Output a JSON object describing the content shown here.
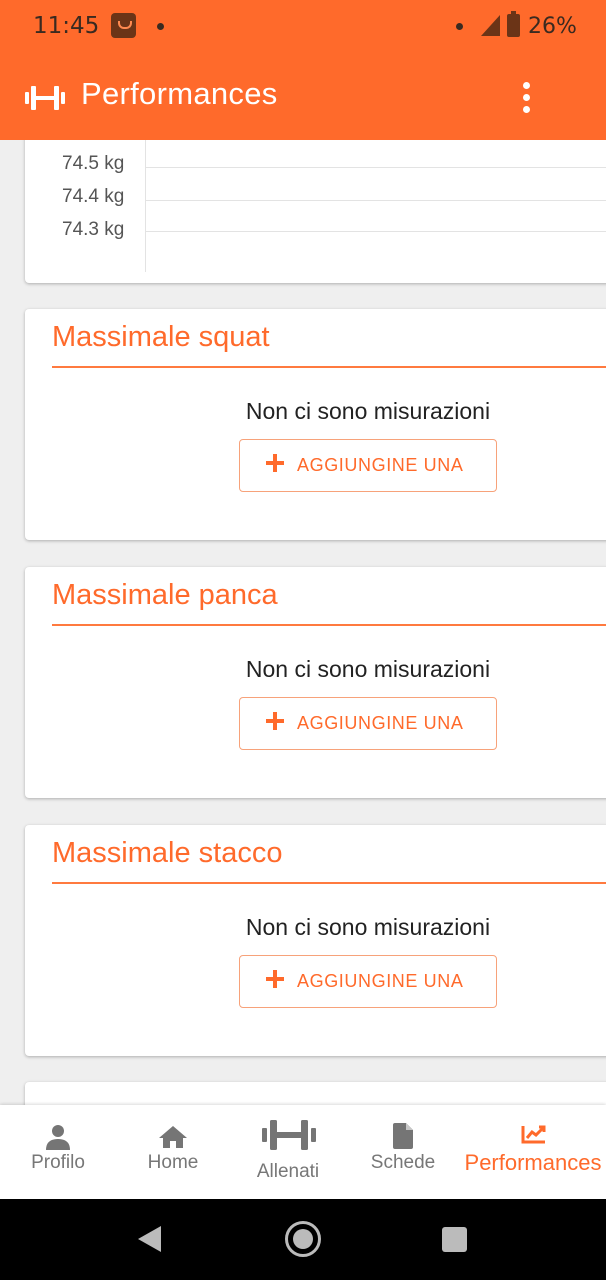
{
  "status_bar": {
    "time": "11:45",
    "battery": "26%"
  },
  "app_bar": {
    "title": "Performances"
  },
  "weight_chart": {
    "y_tick_labels": [
      "74.5 kg",
      "74.4 kg",
      "74.3 kg"
    ]
  },
  "cards": [
    {
      "title": "Massimale squat",
      "empty_message": "Non ci sono misurazioni",
      "button_label": "AGGIUNGINE UNA"
    },
    {
      "title": "Massimale panca",
      "empty_message": "Non ci sono misurazioni",
      "button_label": "AGGIUNGINE UNA"
    },
    {
      "title": "Massimale stacco",
      "empty_message": "Non ci sono misurazioni",
      "button_label": "AGGIUNGINE UNA"
    }
  ],
  "bottom_nav": {
    "items": [
      {
        "label": "Profilo",
        "icon": "person-icon"
      },
      {
        "label": "Home",
        "icon": "home-icon"
      },
      {
        "label": "Allenati",
        "icon": "dumbbell-icon"
      },
      {
        "label": "Schede",
        "icon": "document-icon"
      },
      {
        "label": "Performances",
        "icon": "trending-up-icon",
        "active": true
      }
    ]
  },
  "colors": {
    "primary": "#ff6a2b",
    "background": "#efefef",
    "inactive_nav": "#777777"
  }
}
